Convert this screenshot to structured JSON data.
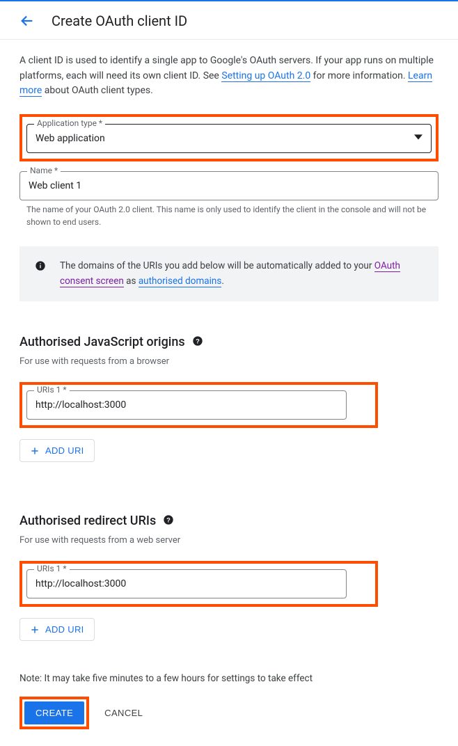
{
  "header": {
    "title": "Create OAuth client ID"
  },
  "intro": {
    "pre": "A client ID is used to identify a single app to Google's OAuth servers. If your app runs on multiple platforms, each will need its own client ID. See ",
    "link1": "Setting up OAuth 2.0",
    "mid": " for more information. ",
    "link2": "Learn more",
    "post": " about OAuth client types."
  },
  "app_type": {
    "label": "Application type *",
    "value": "Web application"
  },
  "name_field": {
    "label": "Name *",
    "value": "Web client 1",
    "helper": "The name of your OAuth 2.0 client. This name is only used to identify the client in the console and will not be shown to end users."
  },
  "banner": {
    "pre": "The domains of the URIs you add below will be automatically added to your ",
    "link": "OAuth consent screen",
    "mid": " as ",
    "link2": "authorised domains",
    "post": "."
  },
  "js_origins": {
    "title": "Authorised JavaScript origins",
    "helper": "For use with requests from a browser",
    "uri_label": "URIs 1 *",
    "uri_value": "http://localhost:3000",
    "add_label": "ADD URI"
  },
  "redirect_uris": {
    "title": "Authorised redirect URIs",
    "helper": "For use with requests from a web server",
    "uri_label": "URIs 1 *",
    "uri_value": "http://localhost:3000",
    "add_label": "ADD URI"
  },
  "note": "Note: It may take five minutes to a few hours for settings to take effect",
  "actions": {
    "create": "CREATE",
    "cancel": "CANCEL"
  }
}
